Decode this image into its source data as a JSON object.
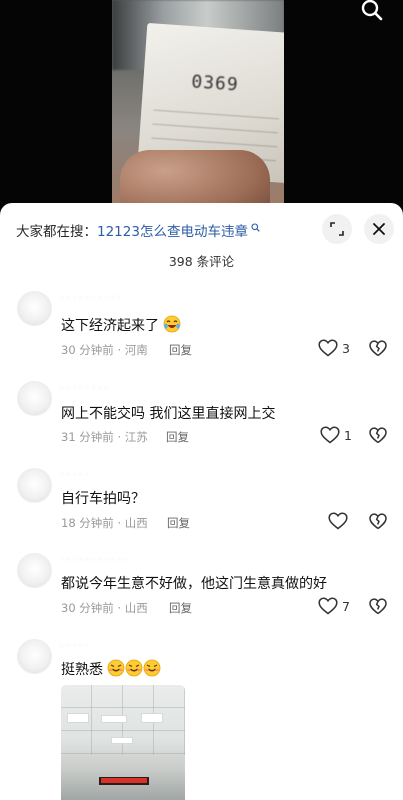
{
  "top_bar": {
    "search_icon": "search-icon"
  },
  "sheet": {
    "hot_search_prefix": "大家都在搜：",
    "hot_search_keyword": "12123怎么查电动车违章",
    "hot_search_suffix_icon": "search-small-icon",
    "expand_icon": "expand-icon",
    "close_icon": "close-icon",
    "comment_count": "398 条评论"
  },
  "comments": [
    {
      "text": "这下经济起来了",
      "emoji": "laughing-crying-emoji",
      "time_location": "30 分钟前 · 河南",
      "reply": "回复",
      "likes": "3"
    },
    {
      "text": "网上不能交吗 我们这里直接网上交",
      "time_location": "31 分钟前 · 江苏",
      "reply": "回复",
      "likes": "1"
    },
    {
      "text": "自行车拍吗？",
      "time_location": "18 分钟前 · 山西",
      "reply": "回复",
      "likes": ""
    },
    {
      "text": "都说今年生意不好做，他这门生意真做的好",
      "time_location": "30 分钟前 · 山西",
      "reply": "回复",
      "likes": "7"
    },
    {
      "text": "挺熟悉",
      "emojis": [
        "relieved-smile-emoji",
        "relieved-smile-emoji",
        "relieved-smile-emoji"
      ],
      "has_photo": true
    }
  ]
}
